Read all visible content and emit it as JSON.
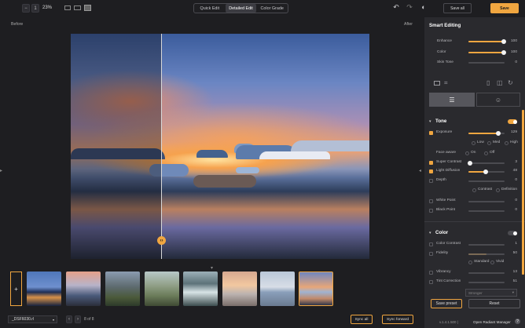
{
  "toolbar": {
    "zoom_minus": "−",
    "zoom_step": "1",
    "zoom_level": "23%",
    "tabs": [
      "Quick Edit",
      "Detailed Edit",
      "Color Grade"
    ],
    "active_tab": "Detailed Edit",
    "save_all_label": "Save all",
    "save_label": "Save"
  },
  "canvas": {
    "before_label": "Before",
    "after_label": "After"
  },
  "filmstrip": {
    "add_label": "+",
    "file_name": "_DSF6030.rl",
    "counter": "8 of 8",
    "sync_all_label": "Sync all",
    "sync_forward_label": "Sync forward"
  },
  "panel": {
    "title": "Smart Editing",
    "smart": [
      {
        "label": "Enhance",
        "value": "100",
        "pct": 1.0
      },
      {
        "label": "Color",
        "value": "100",
        "pct": 1.0
      },
      {
        "label": "Skin Tone",
        "value": "0",
        "pct": 0.0
      }
    ],
    "tone": {
      "title": "Tone",
      "exposure": {
        "label": "Exposure",
        "value": "129",
        "pct": 0.83
      },
      "level_options": [
        "Low",
        "Med",
        "High"
      ],
      "face_aware": {
        "label": "Face aware",
        "options": [
          "On",
          "Off"
        ]
      },
      "super_contrast": {
        "label": "Super Contrast",
        "value": "3",
        "pct": 0.03
      },
      "light_diffusion": {
        "label": "Light Diffusion",
        "value": "48",
        "pct": 0.48
      },
      "depth": {
        "label": "Depth",
        "value": "0",
        "pct": 0.0
      },
      "depth_options": [
        "Contrast",
        "Definition"
      ],
      "white_point": {
        "label": "White Point",
        "value": "0"
      },
      "black_point": {
        "label": "Black Point",
        "value": "0"
      }
    },
    "color": {
      "title": "Color",
      "color_contrast": {
        "label": "Color Contrast",
        "value": "1"
      },
      "fidelity": {
        "label": "Fidelity",
        "value": "50",
        "pct": 0.5
      },
      "fidelity_options": [
        "Standard",
        "Vivid"
      ],
      "vibrancy": {
        "label": "Vibrancy",
        "value": "13"
      },
      "tint_correction": {
        "label": "Tint Correction",
        "value": "51"
      },
      "preset_placeholder": "Stronger"
    },
    "save_preset_label": "Save preset",
    "reset_label": "Reset",
    "version": "v.1.4.1.500 |",
    "manager_label": "Open Radiant Manager"
  },
  "colors": {
    "accent": "#f0a640",
    "panel_bg": "#2a2a2e",
    "app_bg": "#1e1e21"
  }
}
